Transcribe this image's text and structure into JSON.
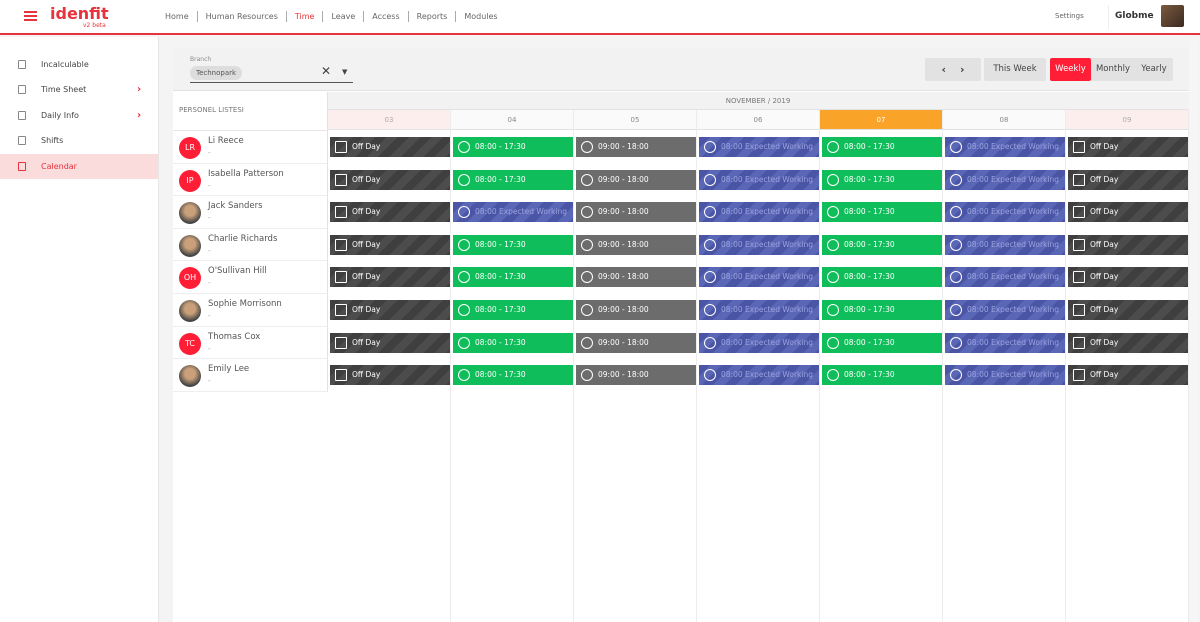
{
  "header": {
    "logo": "idenfit",
    "version": "v2 beta",
    "nav": [
      "Home",
      "Human Resources",
      "Time",
      "Leave",
      "Access",
      "Reports",
      "Modules"
    ],
    "active_nav": "Time",
    "settings": "Settings",
    "user": "Globme"
  },
  "sidebar": {
    "items": [
      {
        "label": "Incalculable",
        "icon": "calendar-x-icon"
      },
      {
        "label": "Time Sheet",
        "icon": "alarm-icon",
        "chevron": true
      },
      {
        "label": "Daily Info",
        "icon": "pie-icon",
        "chevron": true
      },
      {
        "label": "Shifts",
        "icon": "calendar-icon"
      },
      {
        "label": "Calendar",
        "icon": "calendar-icon",
        "active": true
      }
    ]
  },
  "toolbar": {
    "branch_label": "Branch",
    "branch_value": "Technopark",
    "this_week": "This Week",
    "views": [
      "Weekly",
      "Monthly",
      "Yearly"
    ],
    "active_view": "Weekly"
  },
  "calendar": {
    "list_header": "PERSONEL LISTESI",
    "month": "NOVEMBER / 2019",
    "days": [
      "03",
      "04",
      "05",
      "06",
      "07",
      "08",
      "09"
    ],
    "today": "07",
    "weekend": [
      "03",
      "09"
    ],
    "labels": {
      "off": "Off Day",
      "green": "08:00 - 17:30",
      "gray": "09:00 - 18:00",
      "blue": "08:00 Expected Working"
    },
    "people": [
      {
        "name": "Li Reece",
        "sub": "-",
        "initials": "LR",
        "photo": false,
        "cells": [
          "off",
          "green",
          "gray",
          "blue",
          "green",
          "blue",
          "off"
        ]
      },
      {
        "name": "Isabella Patterson",
        "sub": "-",
        "initials": "IP",
        "photo": false,
        "cells": [
          "off",
          "green",
          "gray",
          "blue",
          "green",
          "blue",
          "off"
        ]
      },
      {
        "name": "Jack Sanders",
        "sub": "-",
        "initials": "",
        "photo": true,
        "cells": [
          "off",
          "blue",
          "gray",
          "blue",
          "green",
          "blue",
          "off"
        ]
      },
      {
        "name": "Charlie Richards",
        "sub": "-",
        "initials": "",
        "photo": true,
        "cells": [
          "off",
          "green",
          "gray",
          "blue",
          "green",
          "blue",
          "off"
        ]
      },
      {
        "name": "O'Sullivan Hill",
        "sub": "-",
        "initials": "OH",
        "photo": false,
        "cells": [
          "off",
          "green",
          "gray",
          "blue",
          "green",
          "blue",
          "off"
        ]
      },
      {
        "name": "Sophie Morrisonn",
        "sub": "-",
        "initials": "",
        "photo": true,
        "cells": [
          "off",
          "green",
          "gray",
          "blue",
          "green",
          "blue",
          "off"
        ]
      },
      {
        "name": "Thomas Cox",
        "sub": "-",
        "initials": "TC",
        "photo": false,
        "cells": [
          "off",
          "green",
          "gray",
          "blue",
          "green",
          "blue",
          "off"
        ]
      },
      {
        "name": "Emily Lee",
        "sub": "-",
        "initials": "",
        "photo": true,
        "cells": [
          "off",
          "green",
          "gray",
          "blue",
          "green",
          "blue",
          "off"
        ]
      }
    ]
  },
  "colors": {
    "accent": "#e8323c",
    "today": "#f9a428",
    "green": "#0fbe5a",
    "blue": "#4a55a6"
  }
}
